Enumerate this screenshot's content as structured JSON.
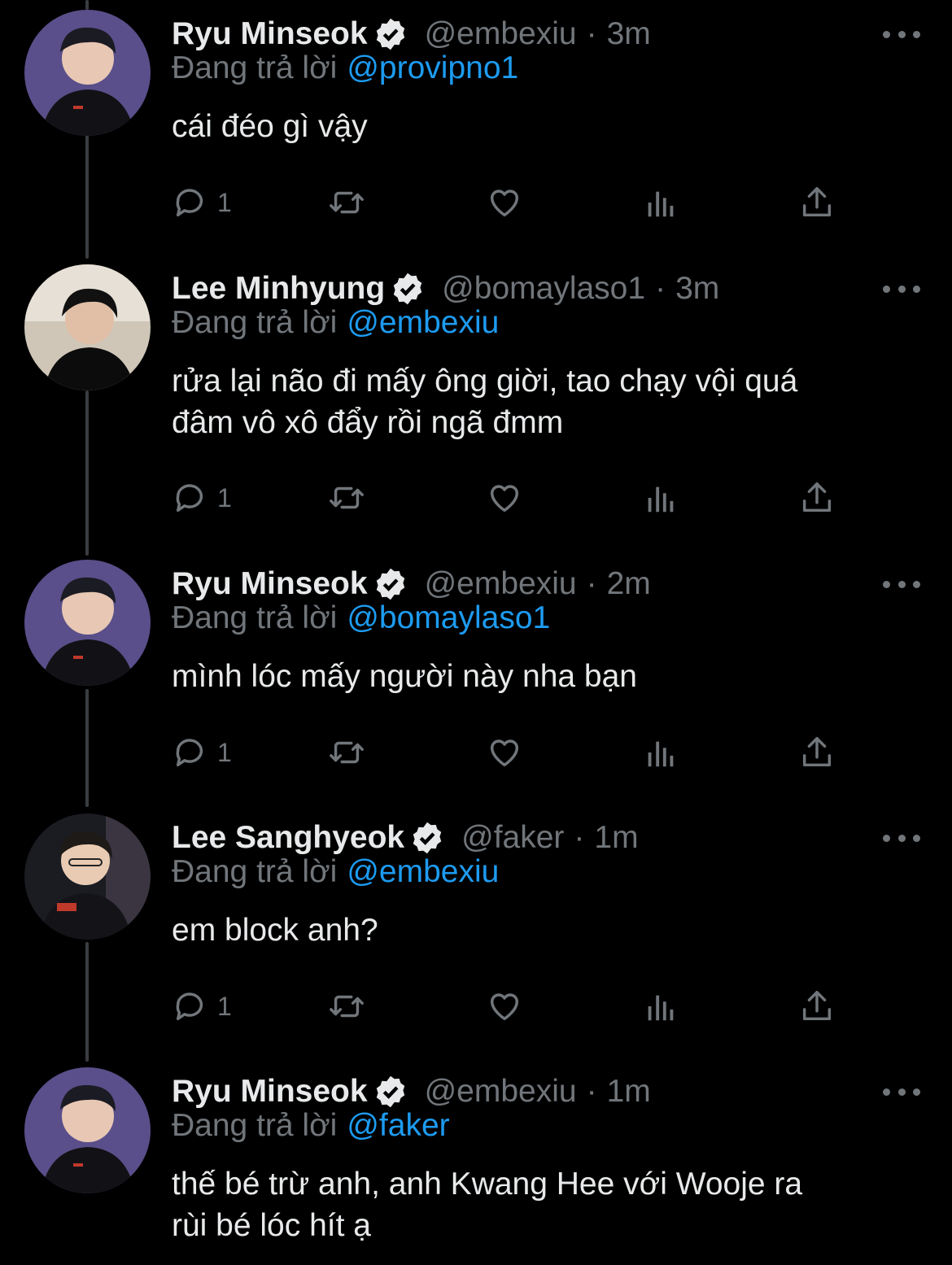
{
  "reply_prefix": "Đang trả lời",
  "colors": {
    "background": "#000000",
    "text": "#e7e9ea",
    "muted": "#71767b",
    "link": "#1d9bf0",
    "verified": "#e7e9ea"
  },
  "tweets": [
    {
      "name": "Ryu Minseok",
      "handle": "@embexiu",
      "separator": "·",
      "time": "3m",
      "reply_to": "@provipno1",
      "text_lines": [
        "cái đéo gì vậy"
      ],
      "reply_count": "1"
    },
    {
      "name": "Lee Minhyung",
      "handle": "@bomaylaso1",
      "separator": "·",
      "time": "3m",
      "reply_to": "@embexiu",
      "text_lines": [
        "rửa lại não đi mấy ông giời, tao chạy vội quá",
        "đâm vô xô đẩy rồi ngã đmm"
      ],
      "reply_count": "1"
    },
    {
      "name": "Ryu Minseok",
      "handle": "@embexiu",
      "separator": "·",
      "time": "2m",
      "reply_to": "@bomaylaso1",
      "text_lines": [
        "mình lóc mấy người này nha bạn"
      ],
      "reply_count": "1"
    },
    {
      "name": "Lee Sanghyeok",
      "handle": "@faker",
      "separator": "·",
      "time": "1m",
      "reply_to": "@embexiu",
      "text_lines": [
        "em block anh?"
      ],
      "reply_count": "1"
    },
    {
      "name": "Ryu Minseok",
      "handle": "@embexiu",
      "separator": "·",
      "time": "1m",
      "reply_to": "@faker",
      "text_lines": [
        "thế bé trừ anh, anh Kwang Hee với Wooje ra",
        "rùi bé lóc hít ạ"
      ],
      "reply_count": ""
    }
  ],
  "icons": [
    "reply-icon",
    "retweet-icon",
    "like-icon",
    "views-icon",
    "share-icon",
    "verified-badge-icon",
    "more-options-icon"
  ]
}
